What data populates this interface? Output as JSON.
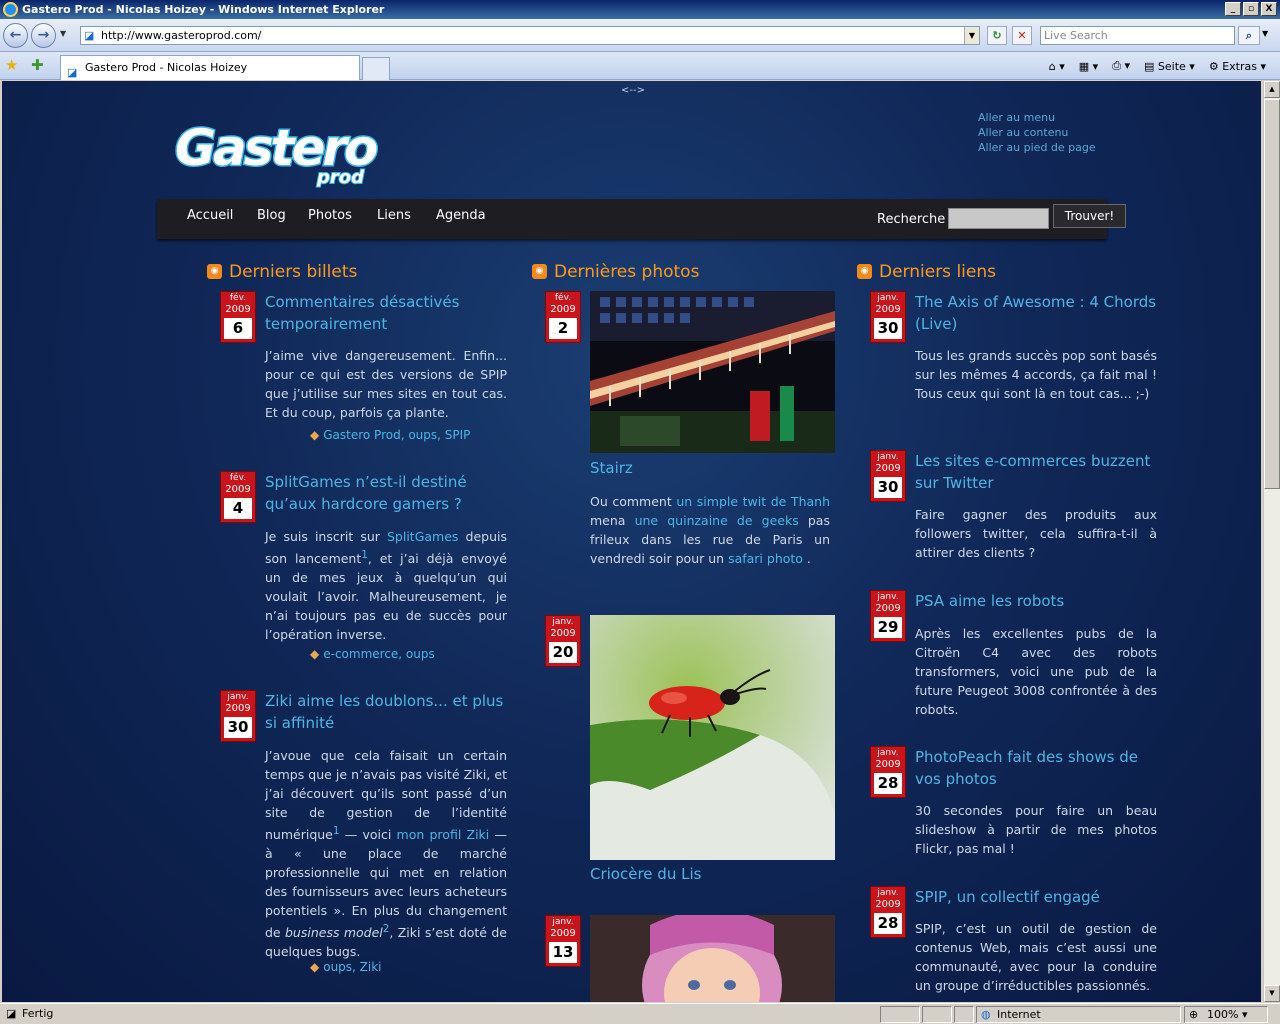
{
  "window": {
    "title": "Gastero Prod - Nicolas Hoizey - Windows Internet Explorer",
    "controls": [
      "_",
      "▫",
      "X"
    ]
  },
  "addressbar": {
    "url": "http://www.gasteroprod.com/",
    "search_placeholder": "Live Search"
  },
  "tabs": {
    "active_label": "Gastero Prod - Nicolas Hoizey"
  },
  "commandbar": {
    "page_label": "Seite",
    "extras_label": "Extras"
  },
  "site": {
    "toggler": "<-->",
    "logo_text": "Gastero",
    "logo_sub": "prod",
    "skiplinks": [
      "Aller au menu",
      "Aller au contenu",
      "Aller au pied de page"
    ],
    "nav": [
      "Accueil",
      "Blog",
      "Photos",
      "Liens",
      "Agenda"
    ],
    "search_label": "Recherche",
    "search_button": "Trouver!"
  },
  "columns": {
    "billets": {
      "heading": "Derniers billets",
      "entries": [
        {
          "month": "fév.",
          "year": "2009",
          "day": "6",
          "title": "Commentaires désactivés temporairement",
          "body": "J’aime vive dangereusement. Enfin... pour ce qui est des versions de SPIP que j’utilise sur mes sites en tout cas. Et du coup, parfois ça plante.",
          "tags": "Gastero Prod, oups, SPIP"
        },
        {
          "month": "fév.",
          "year": "2009",
          "day": "4",
          "title": "SplitGames n’est-il destiné qu’aux hardcore gamers ?",
          "body_pre": "Je suis inscrit sur ",
          "body_link": "SplitGames",
          "body_post": " depuis son lancement",
          "footnote": "1",
          "body_rest": ", et j’ai déjà envoyé un de mes jeux à quelqu’un qui voulait l’avoir. Malheureusement, je n’ai toujours pas eu de succès pour l’opération inverse.",
          "tags": "e-commerce, oups"
        },
        {
          "month": "janv.",
          "year": "2009",
          "day": "30",
          "title": "Ziki aime les doublons... et plus si affinité",
          "body_pre": "J’avoue que cela faisait un certain temps que je n’avais pas visité Ziki, et j’ai découvert qu’ils sont passé d’un site de gestion de l’identité numérique",
          "footnote1": "1",
          "body_mid": " — voici ",
          "body_link": "mon profil Ziki",
          "body_post": " — à « une place de marché professionnelle qui met en relation des fournisseurs avec leurs acheteurs potentiels ». En plus du changement de ",
          "body_em": "business model",
          "footnote2": "2",
          "body_end": ", Ziki s’est doté de quelques bugs.",
          "tags": "oups, Ziki"
        }
      ]
    },
    "photos": {
      "heading": "Dernières photos",
      "entries": [
        {
          "month": "fév.",
          "year": "2009",
          "day": "2",
          "title": "Stairz",
          "body_pre": "Ou comment ",
          "body_link1": "un simple twit de Thanh",
          "body_mid": " mena ",
          "body_link2": "une quinzaine de geeks",
          "body_post": " pas frileux dans les rue de Paris un vendredi soir pour un ",
          "body_link3": "safari photo",
          "body_end": " ."
        },
        {
          "month": "janv.",
          "year": "2009",
          "day": "20",
          "title": "Criocère du Lis"
        },
        {
          "month": "janv.",
          "year": "2009",
          "day": "13"
        }
      ]
    },
    "liens": {
      "heading": "Derniers liens",
      "entries": [
        {
          "month": "janv.",
          "year": "2009",
          "day": "30",
          "title": "The Axis of Awesome : 4 Chords (Live)",
          "body": "Tous les grands succès pop sont basés sur les mêmes 4 accords, ça fait mal ! Tous ceux qui sont là en tout cas... ;-)"
        },
        {
          "month": "janv.",
          "year": "2009",
          "day": "30",
          "title": "Les sites e-commerces buzzent sur Twitter",
          "body": "Faire gagner des produits aux followers twitter, cela suffira-t-il à attirer des clients ?"
        },
        {
          "month": "janv.",
          "year": "2009",
          "day": "29",
          "title": "PSA aime les robots",
          "body": "Après les excellentes pubs de la Citroën C4 avec des robots transformers, voici une pub de la future Peugeot 3008 confrontée à des robots."
        },
        {
          "month": "janv.",
          "year": "2009",
          "day": "28",
          "title": "PhotoPeach fait des shows de vos photos",
          "body": "30 secondes pour faire un beau slideshow à partir de mes photos Flickr, pas mal !"
        },
        {
          "month": "janv.",
          "year": "2009",
          "day": "28",
          "title": "SPIP, un collectif engagé",
          "body": "SPIP, c’est un outil de gestion de contenus Web, mais c’est aussi une communauté, avec pour la conduire un groupe d’irréductibles passionnés."
        }
      ]
    }
  },
  "statusbar": {
    "status": "Fertig",
    "zone": "Internet",
    "zoom": "100%"
  },
  "colors": {
    "accent_orange": "#ff9a1a",
    "link_blue": "#4bb6e6",
    "date_red": "#c8141a",
    "page_bg": "#102858"
  }
}
